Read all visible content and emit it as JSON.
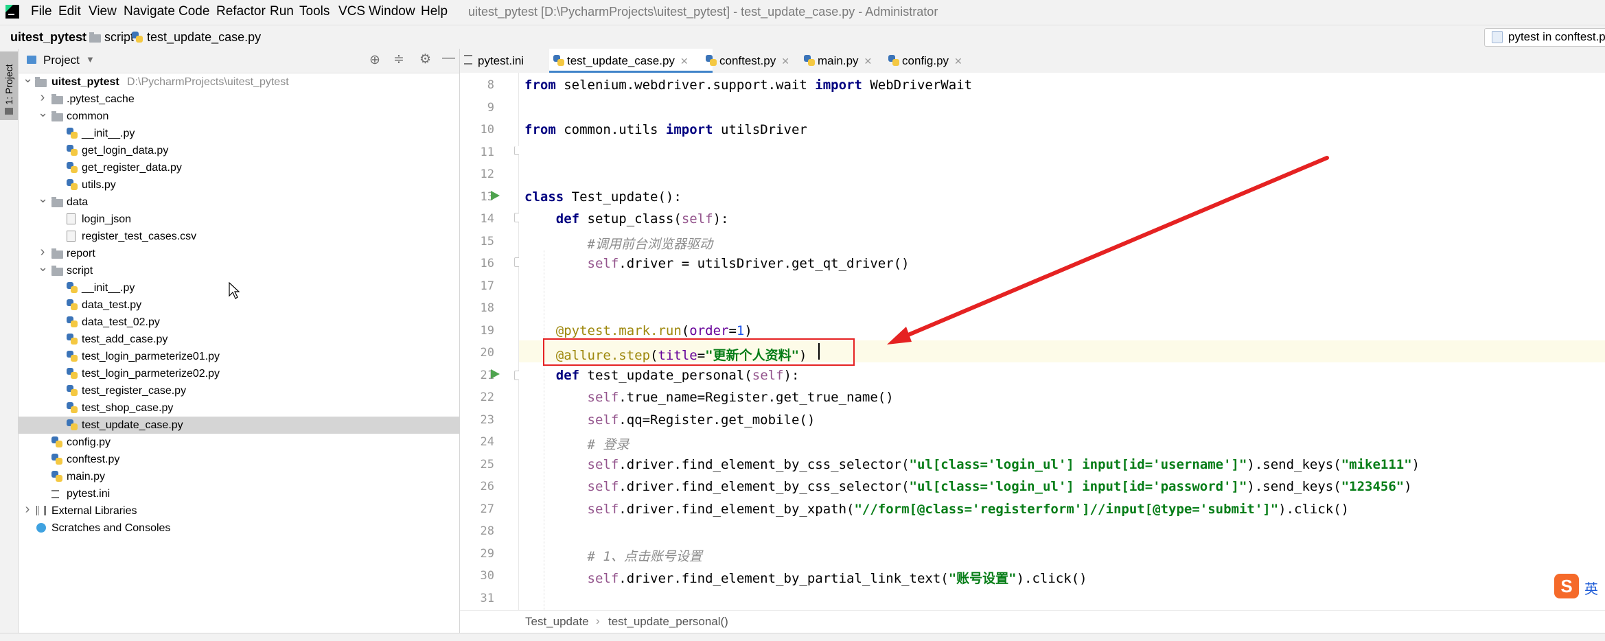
{
  "menu": {
    "items": [
      "File",
      "Edit",
      "View",
      "Navigate",
      "Code",
      "Refactor",
      "Run",
      "Tools",
      "VCS",
      "Window",
      "Help"
    ],
    "window_title": "uitest_pytest [D:\\PycharmProjects\\uitest_pytest] - test_update_case.py - Administrator"
  },
  "navbar": {
    "crumbs": [
      "uitest_pytest",
      "script",
      "test_update_case.py"
    ],
    "run_config": "pytest in conftest.p"
  },
  "left_strip": {
    "project_tab": "1: Project"
  },
  "project_panel": {
    "title": "Project",
    "tree": [
      {
        "label": "uitest_pytest",
        "path": "D:\\PycharmProjects\\uitest_pytest",
        "bold": true,
        "expanded": true,
        "type": "folder"
      },
      {
        "label": ".pytest_cache",
        "type": "folder",
        "collapsed": true
      },
      {
        "label": "common",
        "type": "folder",
        "expanded": true
      },
      {
        "label": "__init__.py",
        "type": "py"
      },
      {
        "label": "get_login_data.py",
        "type": "py"
      },
      {
        "label": "get_register_data.py",
        "type": "py"
      },
      {
        "label": "utils.py",
        "type": "py"
      },
      {
        "label": "data",
        "type": "folder",
        "expanded": true
      },
      {
        "label": "login_json",
        "type": "json"
      },
      {
        "label": "register_test_cases.csv",
        "type": "csv"
      },
      {
        "label": "report",
        "type": "folder",
        "collapsed": true
      },
      {
        "label": "script",
        "type": "folder",
        "expanded": true
      },
      {
        "label": "__init__.py",
        "type": "py"
      },
      {
        "label": "data_test.py",
        "type": "py"
      },
      {
        "label": "data_test_02.py",
        "type": "py"
      },
      {
        "label": "test_add_case.py",
        "type": "py"
      },
      {
        "label": "test_login_parmeterize01.py",
        "type": "py"
      },
      {
        "label": "test_login_parmeterize02.py",
        "type": "py"
      },
      {
        "label": "test_register_case.py",
        "type": "py"
      },
      {
        "label": "test_shop_case.py",
        "type": "py"
      },
      {
        "label": "test_update_case.py",
        "type": "py",
        "selected": true
      },
      {
        "label": "config.py",
        "type": "py"
      },
      {
        "label": "conftest.py",
        "type": "py"
      },
      {
        "label": "main.py",
        "type": "py"
      },
      {
        "label": "pytest.ini",
        "type": "ini"
      },
      {
        "label": "External Libraries",
        "type": "lib",
        "collapsed": true
      },
      {
        "label": "Scratches and Consoles",
        "type": "scratch"
      }
    ]
  },
  "editor": {
    "tabs": [
      {
        "label": "pytest.ini",
        "active": false
      },
      {
        "label": "test_update_case.py",
        "active": true
      },
      {
        "label": "conftest.py",
        "active": false
      },
      {
        "label": "main.py",
        "active": false
      },
      {
        "label": "config.py",
        "active": false
      }
    ],
    "line_numbers": [
      "8",
      "9",
      "10",
      "11",
      "12",
      "13",
      "14",
      "15",
      "16",
      "17",
      "18",
      "19",
      "20",
      "21",
      "22",
      "23",
      "24",
      "25",
      "26",
      "27",
      "28",
      "29",
      "30",
      "31"
    ],
    "lines": {
      "l8": [
        "from",
        " selenium.webdriver.support.wait ",
        "import",
        " WebDriverWait"
      ],
      "l10": [
        "from",
        " common.utils ",
        "import",
        " utilsDriver"
      ],
      "l13": [
        "class",
        " Test_update():"
      ],
      "l14": [
        "    ",
        "def",
        " setup_class(",
        "self",
        "):"
      ],
      "l15": [
        "        ",
        "#调用前台浏览器驱动"
      ],
      "l16": [
        "        ",
        "self",
        ".driver = utilsDriver.get_qt_driver()"
      ],
      "l19": [
        "    ",
        "@pytest.mark.run",
        "(",
        "order",
        "=",
        "1",
        ")"
      ],
      "l20": [
        "    ",
        "@allure.step",
        "(",
        "title",
        "=",
        "\"更新个人资料\"",
        ")"
      ],
      "l21": [
        "    ",
        "def",
        " test_update_personal(",
        "self",
        "):"
      ],
      "l22": [
        "        ",
        "self",
        ".true_name=Register.get_true_name()"
      ],
      "l23": [
        "        ",
        "self",
        ".qq=Register.get_mobile()"
      ],
      "l24": [
        "        ",
        "# 登录"
      ],
      "l25": [
        "        ",
        "self",
        ".driver.find_element_by_css_selector(",
        "\"ul[class='login_ul'] input[id='username']\"",
        ").send_keys(",
        "\"mike111\"",
        ")"
      ],
      "l26": [
        "        ",
        "self",
        ".driver.find_element_by_css_selector(",
        "\"ul[class='login_ul'] input[id='password']\"",
        ").send_keys(",
        "\"123456\"",
        ")"
      ],
      "l27": [
        "        ",
        "self",
        ".driver.find_element_by_xpath(",
        "\"//form[@class='registerform']//input[@type='submit']\"",
        ").click()"
      ],
      "l29": [
        "        ",
        "# 1、点击账号设置"
      ],
      "l30": [
        "        ",
        "self",
        ".driver.find_element_by_partial_link_text(",
        "\"账号设置\"",
        ").click()"
      ]
    },
    "breadcrumb": [
      "Test_update",
      "test_update_personal()"
    ]
  },
  "ime": {
    "label": "英"
  },
  "colors": {
    "accent": "#4083c9",
    "annotation": "#e52222",
    "run_green": "#4fa34f"
  }
}
